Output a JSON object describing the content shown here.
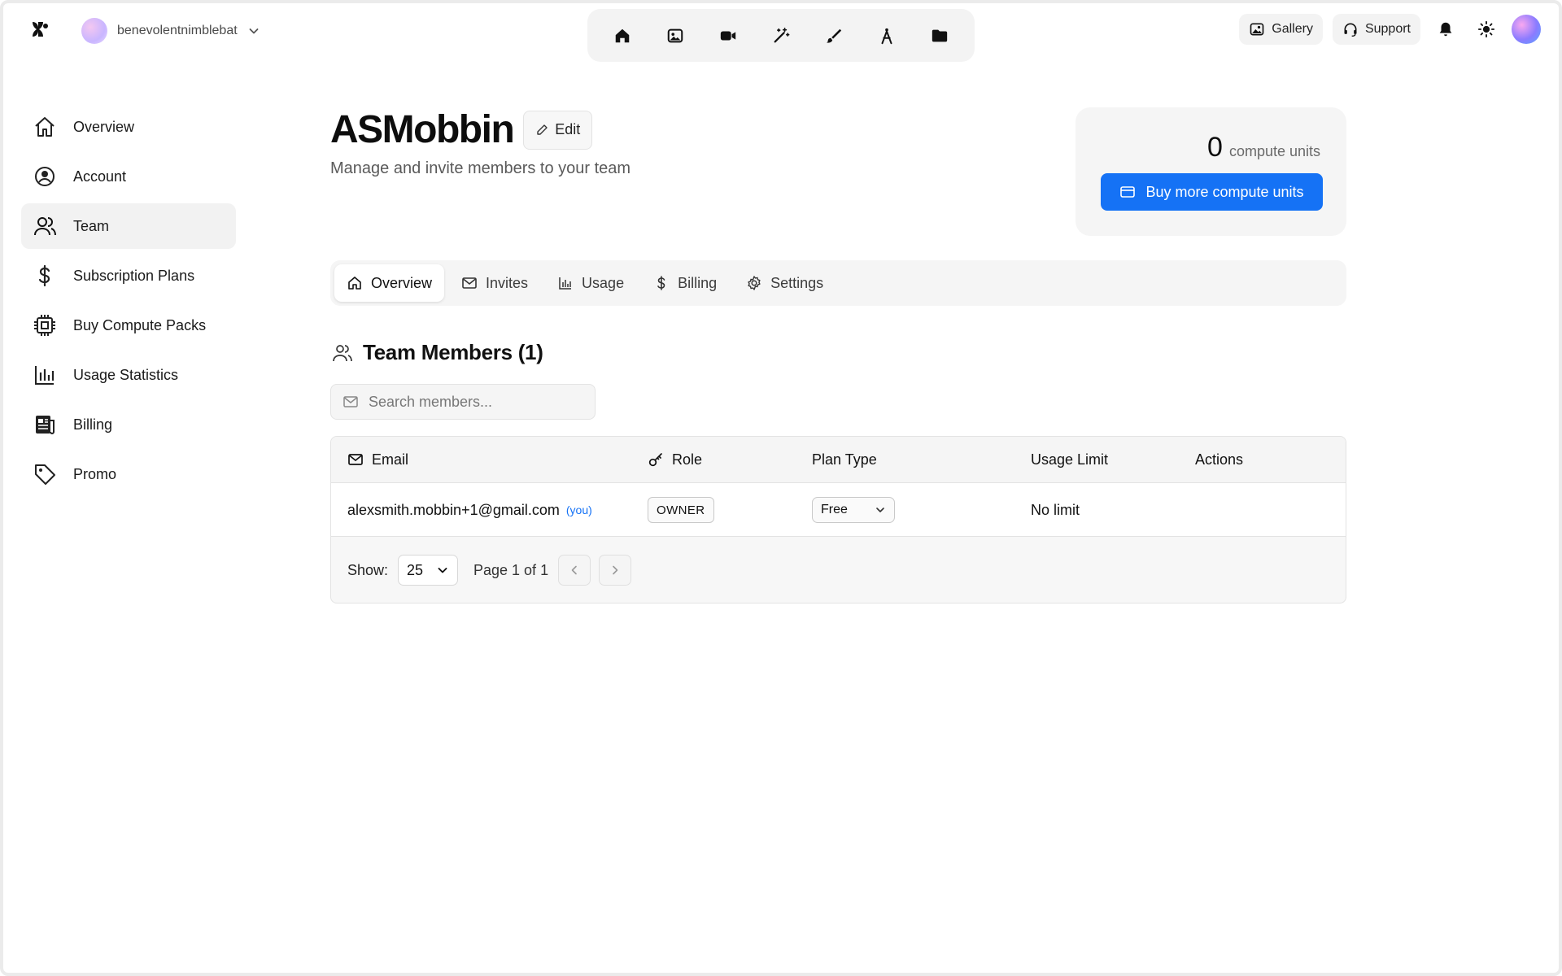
{
  "header": {
    "workspace_name": "benevolentnimblebat",
    "gallery_label": "Gallery",
    "support_label": "Support"
  },
  "sidebar": {
    "items": [
      {
        "label": "Overview"
      },
      {
        "label": "Account"
      },
      {
        "label": "Team"
      },
      {
        "label": "Subscription Plans"
      },
      {
        "label": "Buy Compute Packs"
      },
      {
        "label": "Usage Statistics"
      },
      {
        "label": "Billing"
      },
      {
        "label": "Promo"
      }
    ]
  },
  "page": {
    "title": "ASMobbin",
    "edit_label": "Edit",
    "subtitle": "Manage and invite members to your team"
  },
  "compute": {
    "amount": "0",
    "unit": "compute units",
    "buy_label": "Buy more compute units"
  },
  "tabs": [
    {
      "label": "Overview"
    },
    {
      "label": "Invites"
    },
    {
      "label": "Usage"
    },
    {
      "label": "Billing"
    },
    {
      "label": "Settings"
    }
  ],
  "members": {
    "title": "Team Members (1)",
    "search_placeholder": "Search members...",
    "columns": {
      "email": "Email",
      "role": "Role",
      "plan_type": "Plan Type",
      "usage_limit": "Usage Limit",
      "actions": "Actions"
    },
    "rows": [
      {
        "email": "alexsmith.mobbin+1@gmail.com",
        "you_tag": "(you)",
        "role": "OWNER",
        "plan": "Free",
        "usage_limit": "No limit"
      }
    ],
    "footer": {
      "show_label": "Show:",
      "page_size": "25",
      "page_info": "Page 1 of 1"
    }
  },
  "colors": {
    "accent": "#1572f5",
    "surface": "#f5f5f5",
    "border": "#e3e3e3"
  }
}
